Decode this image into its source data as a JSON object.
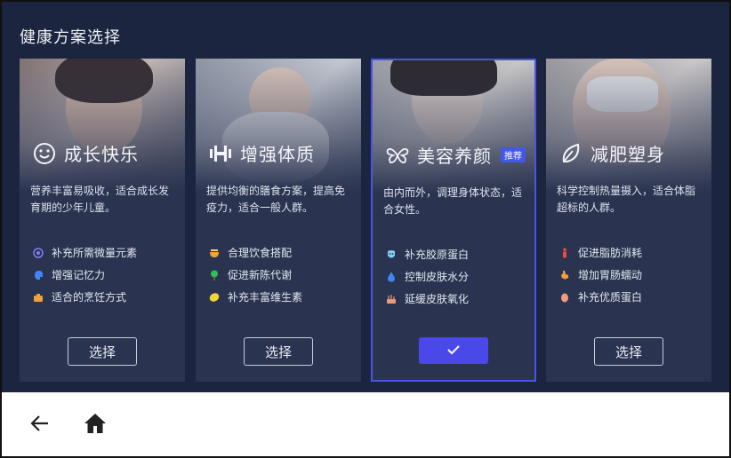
{
  "header": {
    "title": "健康方案选择"
  },
  "cards": [
    {
      "title": "成长快乐",
      "description": "营养丰富易吸收，适合成长发育期的少年儿童。",
      "features": [
        "补充所需微量元素",
        "增强记忆力",
        "适合的烹饪方式"
      ],
      "button_label": "选择",
      "selected": false
    },
    {
      "title": "增强体质",
      "description": "提供均衡的膳食方案，提高免疫力，适合一般人群。",
      "features": [
        "合理饮食搭配",
        "促进新陈代谢",
        "补充丰富维生素"
      ],
      "button_label": "选择",
      "selected": false
    },
    {
      "title": "美容养颜",
      "badge": "推荐",
      "description": "由内而外，调理身体状态，适合女性。",
      "features": [
        "补充胶原蛋白",
        "控制皮肤水分",
        "延缓皮肤氧化"
      ],
      "button_label": "✓",
      "selected": true
    },
    {
      "title": "减肥塑身",
      "description": "科学控制热量摄入，适合体脂超标的人群。",
      "features": [
        "促进脂肪消耗",
        "增加胃肠蠕动",
        "补充优质蛋白"
      ],
      "button_label": "选择",
      "selected": false
    }
  ],
  "icons": {
    "card_icons": [
      "smiley-icon",
      "dumbbell-icon",
      "butterfly-icon",
      "leaf-icon"
    ],
    "nav": [
      "back-arrow-icon",
      "home-icon"
    ]
  },
  "colors": {
    "background": "#1c2540",
    "card": "#2a3350",
    "accent": "#4a48e8",
    "badge": "#4458e8"
  }
}
